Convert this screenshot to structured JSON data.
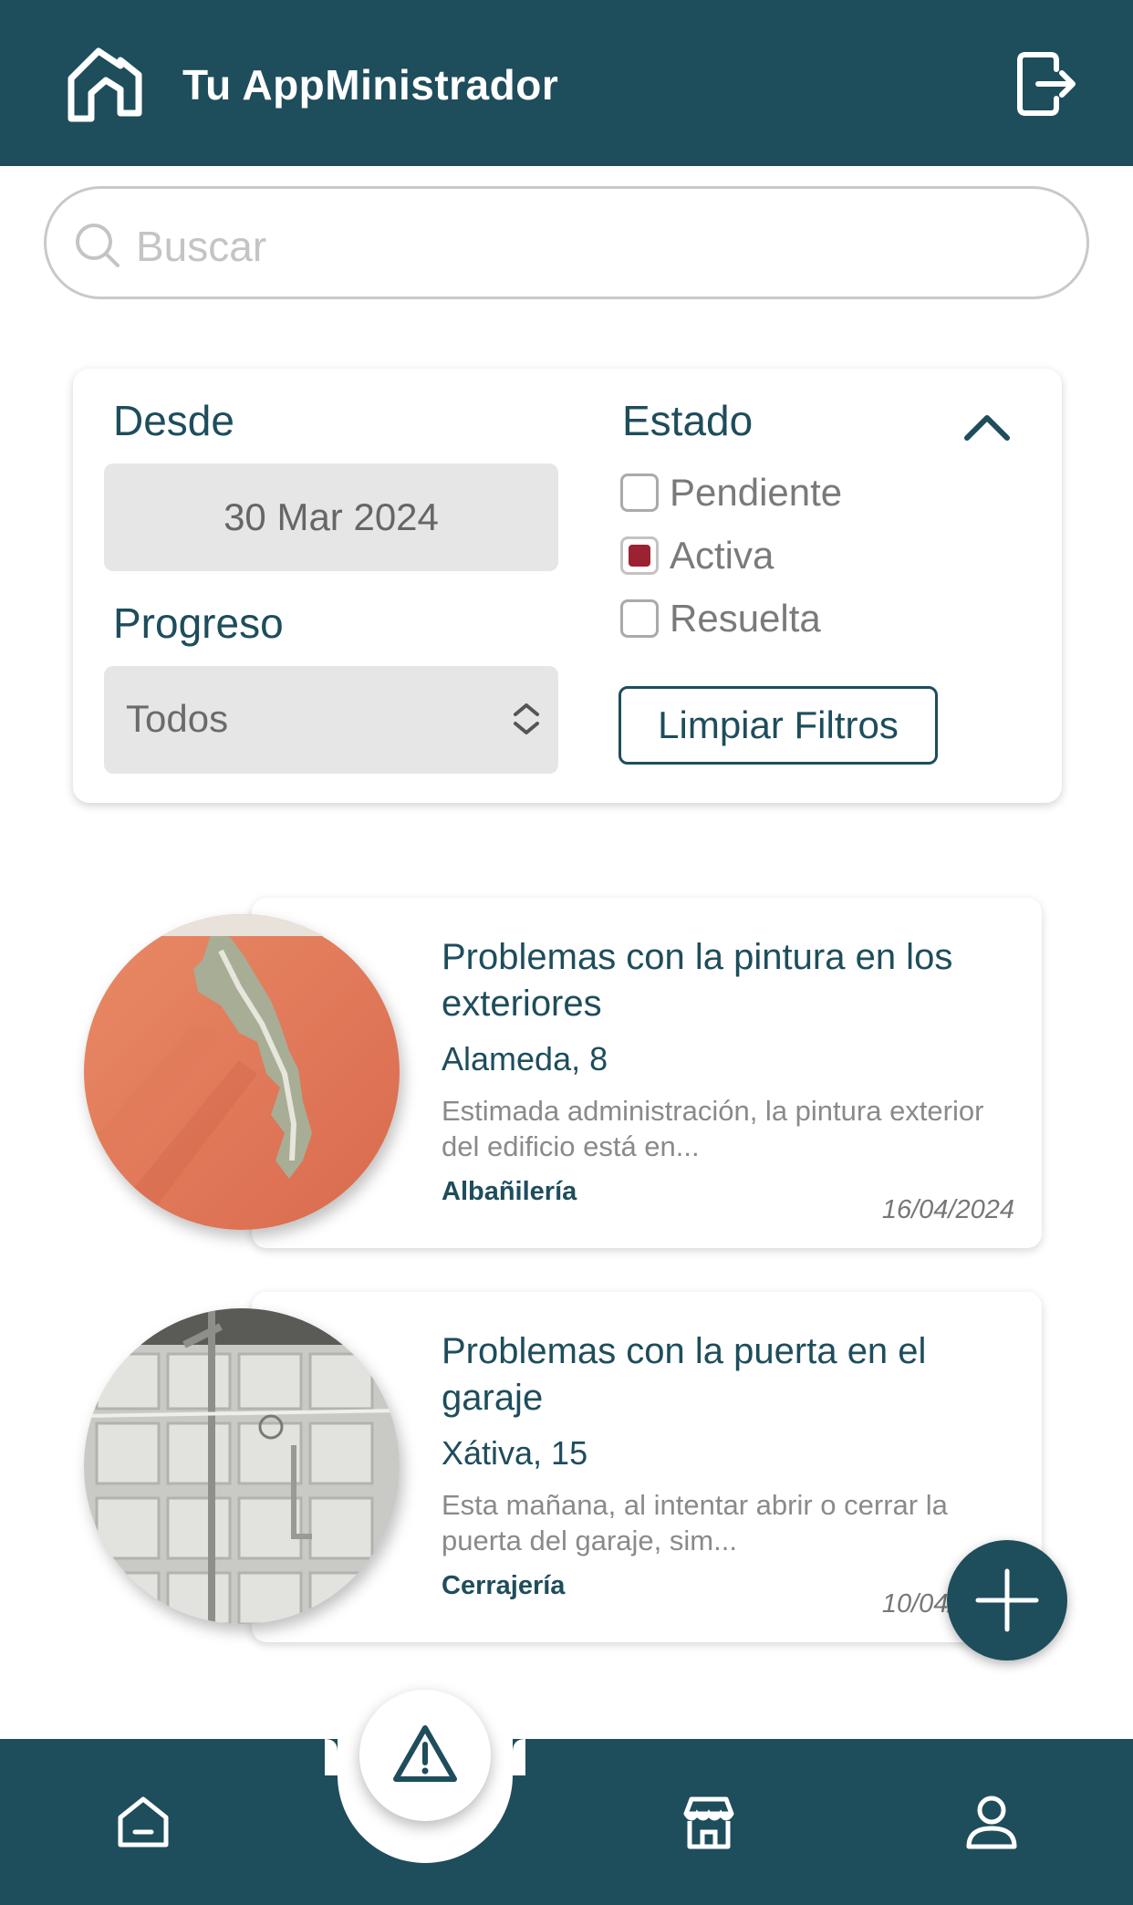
{
  "header": {
    "title": "Tu AppMinistrador",
    "logo": "house-outline-logo",
    "logout_icon": "logout-icon"
  },
  "search": {
    "placeholder": "Buscar",
    "icon": "search-icon"
  },
  "filters": {
    "from_label": "Desde",
    "from_value": "30 Mar 2024",
    "progress_label": "Progreso",
    "progress_value": "Todos",
    "status_label": "Estado",
    "status_options": [
      {
        "label": "Pendiente",
        "checked": false
      },
      {
        "label": "Activa",
        "checked": true
      },
      {
        "label": "Resuelta",
        "checked": false
      }
    ],
    "clear_label": "Limpiar Filtros",
    "collapse_icon": "chevron-up-icon"
  },
  "incidents": [
    {
      "title": "Problemas con la pintura en los exteriores",
      "address": "Alameda, 8",
      "description": "Estimada administración, la pintura exterior del edificio está en...",
      "category": "Albañilería",
      "date": "16/04/2024",
      "photo": "peeling-paint-photo"
    },
    {
      "title": "Problemas con la puerta en el garaje",
      "address": "Xátiva, 15",
      "description": "Esta mañana, al intentar abrir o cerrar la puerta del garaje, sim...",
      "category": "Cerrajería",
      "date": "10/04/2024",
      "photo": "garage-door-photo"
    }
  ],
  "fab": {
    "icon": "plus-icon"
  },
  "bottom_nav": {
    "items": [
      "home-icon",
      "alert-icon",
      "store-icon",
      "user-icon"
    ],
    "active": "alert-icon"
  },
  "colors": {
    "primary": "#1e4d5c",
    "checked": "#9b2232",
    "field_bg": "#e6e6e6"
  }
}
